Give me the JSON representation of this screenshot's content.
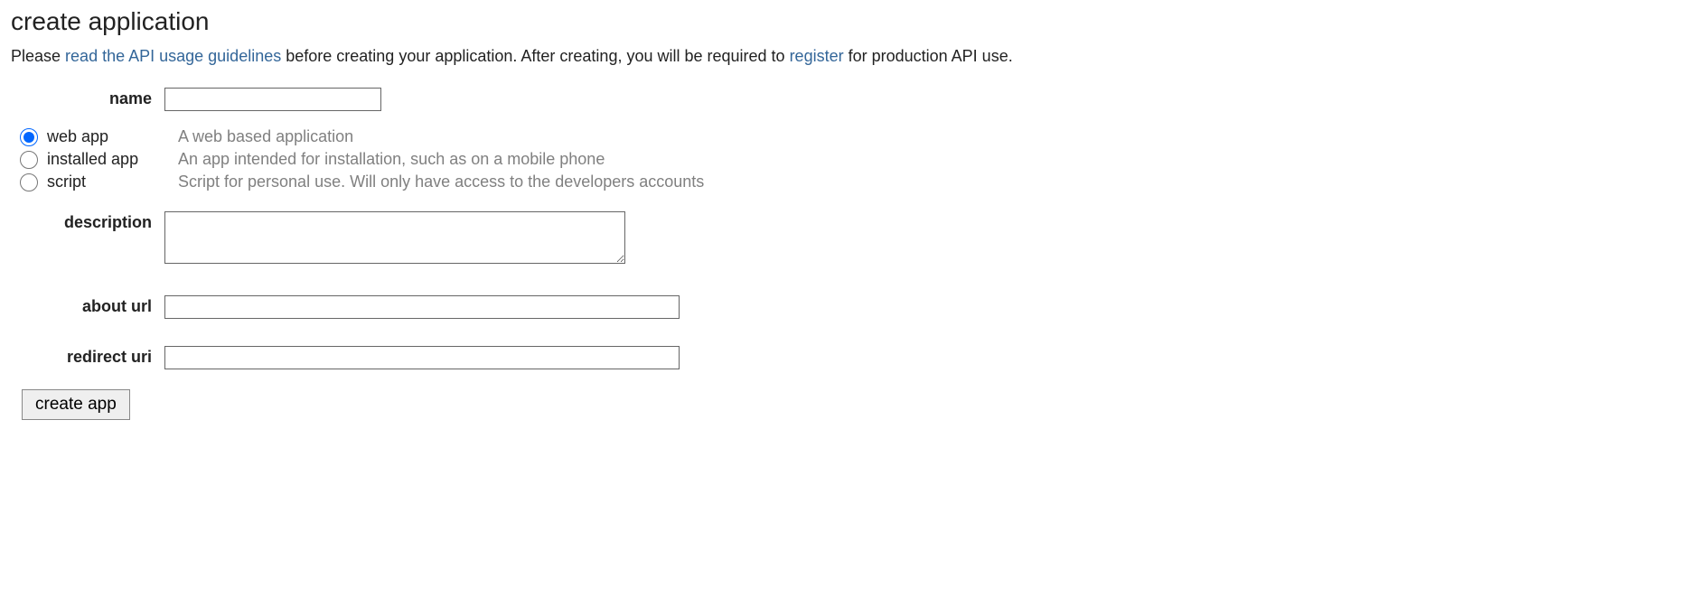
{
  "title": "create application",
  "intro": {
    "prefix": "Please ",
    "link1": "read the API usage guidelines",
    "middle": " before creating your application. After creating, you will be required to ",
    "link2": "register",
    "suffix": " for production API use."
  },
  "form": {
    "name_label": "name",
    "name_value": "",
    "description_label": "description",
    "description_value": "",
    "about_url_label": "about url",
    "about_url_value": "",
    "redirect_uri_label": "redirect uri",
    "redirect_uri_value": "",
    "submit_label": "create app"
  },
  "app_types": [
    {
      "label": "web app",
      "desc": "A web based application",
      "checked": true
    },
    {
      "label": "installed app",
      "desc": "An app intended for installation, such as on a mobile phone",
      "checked": false
    },
    {
      "label": "script",
      "desc": "Script for personal use. Will only have access to the developers accounts",
      "checked": false
    }
  ]
}
